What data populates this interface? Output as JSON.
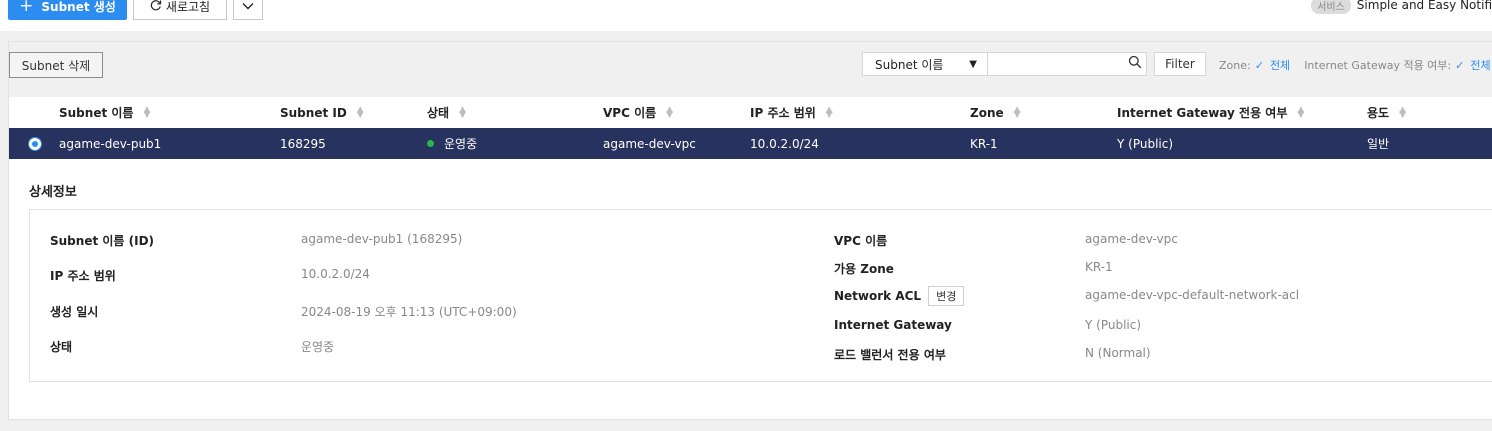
{
  "topbar": {
    "create_button": "Subnet 생성",
    "refresh_button": "새로고침",
    "service_badge": "서비스",
    "service_name": "Simple and Easy Notifi"
  },
  "toolbar": {
    "delete_button": "Subnet 삭제",
    "search_field_select": "Subnet 이름",
    "search_placeholder": "",
    "filter_button": "Filter",
    "zone_label": "Zone:",
    "zone_value": "전체",
    "igw_label": "Internet Gateway 적용 여부:",
    "igw_value": "전체"
  },
  "table": {
    "headers": [
      "Subnet 이름",
      "Subnet ID",
      "상태",
      "VPC 이름",
      "IP 주소 범위",
      "Zone",
      "Internet Gateway 전용 여부",
      "용도"
    ],
    "rows": [
      {
        "name": "agame-dev-pub1",
        "id": "168295",
        "status": "운영중",
        "vpc": "agame-dev-vpc",
        "ip_range": "10.0.2.0/24",
        "zone": "KR-1",
        "igw": "Y (Public)",
        "usage": "일반"
      }
    ]
  },
  "detail": {
    "title": "상세정보",
    "left": [
      {
        "label": "Subnet 이름 (ID)",
        "value": "agame-dev-pub1 (168295)"
      },
      {
        "label": "IP 주소 범위",
        "value": "10.0.2.0/24"
      },
      {
        "label": "생성 일시",
        "value": "2024-08-19 오후 11:13 (UTC+09:00)"
      },
      {
        "label": "상태",
        "value": "운영중"
      }
    ],
    "right": [
      {
        "label": "VPC 이름",
        "value": "agame-dev-vpc"
      },
      {
        "label": "가용 Zone",
        "value": "KR-1"
      },
      {
        "label": "Network ACL",
        "value": "agame-dev-vpc-default-network-acl"
      },
      {
        "label": "Internet Gateway",
        "value": "Y (Public)"
      },
      {
        "label": "로드 밸런서 전용 여부",
        "value": "N (Normal)"
      }
    ],
    "acl_change_button": "변경"
  },
  "colors": {
    "accent": "#2c8cf0",
    "selected_row": "#28325e",
    "status_running": "#25b84a"
  }
}
